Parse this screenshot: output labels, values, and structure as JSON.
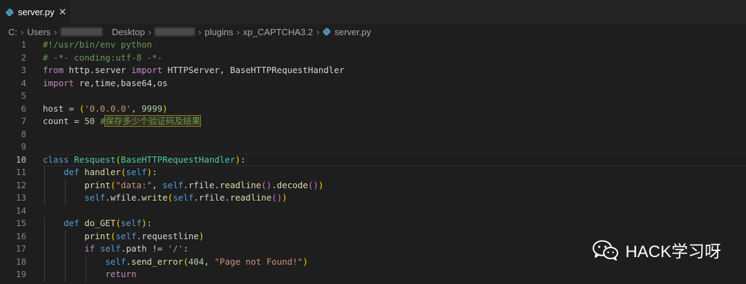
{
  "tab": {
    "label": "server.py",
    "close_glyph": "✕",
    "icon": "python-icon"
  },
  "breadcrumb": {
    "items": [
      "C:",
      "Users",
      "Desktop",
      "plugins",
      "xp_CAPTCHA3.2",
      "server.py"
    ],
    "separator": "›"
  },
  "watermark": {
    "text": "HACK学习呀",
    "icon": "wechat-icon"
  },
  "colors": {
    "background": "#1e1e1e",
    "keyword": "#569cd6",
    "control": "#c586c0",
    "class": "#4ec9b0",
    "function": "#dcdcaa",
    "string": "#ce9178",
    "number": "#b5cea8",
    "comment": "#6a9955"
  },
  "editor": {
    "current_line": 10,
    "lines": [
      {
        "n": "1",
        "t": [
          [
            "cm",
            "#!/usr/bin/env python"
          ]
        ]
      },
      {
        "n": "2",
        "t": [
          [
            "cm",
            "# -*- conding:utf-8 -*-"
          ]
        ]
      },
      {
        "n": "3",
        "t": [
          [
            "ctl",
            "from"
          ],
          [
            "plain",
            " http.server "
          ],
          [
            "ctl",
            "import"
          ],
          [
            "plain",
            " HTTPServer, BaseHTTPRequestHandler"
          ]
        ]
      },
      {
        "n": "4",
        "t": [
          [
            "ctl",
            "import"
          ],
          [
            "plain",
            " re,time,base64,os"
          ]
        ]
      },
      {
        "n": "5",
        "t": []
      },
      {
        "n": "6",
        "t": [
          [
            "plain",
            "host = "
          ],
          [
            "br1",
            "("
          ],
          [
            "str",
            "'0.0.0.0'"
          ],
          [
            "plain",
            ", "
          ],
          [
            "num",
            "9999"
          ],
          [
            "br1",
            ")"
          ]
        ]
      },
      {
        "n": "7",
        "t": [
          [
            "plain",
            "count = "
          ],
          [
            "num",
            "50"
          ],
          [
            "plain",
            " "
          ],
          [
            "cm",
            "#"
          ],
          [
            "cmhl",
            "保存多少个验证码及结果"
          ]
        ]
      },
      {
        "n": "8",
        "t": []
      },
      {
        "n": "9",
        "t": []
      },
      {
        "n": "10",
        "t": [
          [
            "kw",
            "class"
          ],
          [
            "plain",
            " "
          ],
          [
            "cls",
            "Resquest"
          ],
          [
            "br1",
            "("
          ],
          [
            "cls",
            "BaseHTTPRequestHandler"
          ],
          [
            "br1",
            ")"
          ],
          [
            "plain",
            ":"
          ]
        ]
      },
      {
        "n": "11",
        "t": [
          [
            "plain",
            "    "
          ],
          [
            "kw",
            "def"
          ],
          [
            "plain",
            " "
          ],
          [
            "fn",
            "handler"
          ],
          [
            "br1",
            "("
          ],
          [
            "slf",
            "self"
          ],
          [
            "br1",
            ")"
          ],
          [
            "plain",
            ":"
          ]
        ]
      },
      {
        "n": "12",
        "t": [
          [
            "plain",
            "        "
          ],
          [
            "fn",
            "print"
          ],
          [
            "br1",
            "("
          ],
          [
            "str",
            "\"data:\""
          ],
          [
            "plain",
            ", "
          ],
          [
            "slf",
            "self"
          ],
          [
            "plain",
            ".rfile."
          ],
          [
            "fn",
            "readline"
          ],
          [
            "br2",
            "()"
          ],
          [
            "plain",
            "."
          ],
          [
            "fn",
            "decode"
          ],
          [
            "br2",
            "()"
          ],
          [
            "br1",
            ")"
          ]
        ]
      },
      {
        "n": "13",
        "t": [
          [
            "plain",
            "        "
          ],
          [
            "slf",
            "self"
          ],
          [
            "plain",
            ".wfile."
          ],
          [
            "fn",
            "write"
          ],
          [
            "br1",
            "("
          ],
          [
            "slf",
            "self"
          ],
          [
            "plain",
            ".rfile."
          ],
          [
            "fn",
            "readline"
          ],
          [
            "br2",
            "()"
          ],
          [
            "br1",
            ")"
          ]
        ]
      },
      {
        "n": "14",
        "t": []
      },
      {
        "n": "15",
        "t": [
          [
            "plain",
            "    "
          ],
          [
            "kw",
            "def"
          ],
          [
            "plain",
            " "
          ],
          [
            "fn",
            "do_GET"
          ],
          [
            "br1",
            "("
          ],
          [
            "slf",
            "self"
          ],
          [
            "br1",
            ")"
          ],
          [
            "plain",
            ":"
          ]
        ]
      },
      {
        "n": "16",
        "t": [
          [
            "plain",
            "        "
          ],
          [
            "fn",
            "print"
          ],
          [
            "br1",
            "("
          ],
          [
            "slf",
            "self"
          ],
          [
            "plain",
            ".requestline"
          ],
          [
            "br1",
            ")"
          ]
        ]
      },
      {
        "n": "17",
        "t": [
          [
            "plain",
            "        "
          ],
          [
            "ctl",
            "if"
          ],
          [
            "plain",
            " "
          ],
          [
            "slf",
            "self"
          ],
          [
            "plain",
            ".path != "
          ],
          [
            "str",
            "'/'"
          ],
          [
            "plain",
            ":"
          ]
        ]
      },
      {
        "n": "18",
        "t": [
          [
            "plain",
            "            "
          ],
          [
            "slf",
            "self"
          ],
          [
            "plain",
            "."
          ],
          [
            "fn",
            "send_error"
          ],
          [
            "br1",
            "("
          ],
          [
            "num",
            "404"
          ],
          [
            "plain",
            ", "
          ],
          [
            "str",
            "\"Page not Found!\""
          ],
          [
            "br1",
            ")"
          ]
        ]
      },
      {
        "n": "19",
        "t": [
          [
            "plain",
            "            "
          ],
          [
            "ctl",
            "return"
          ]
        ]
      }
    ]
  }
}
